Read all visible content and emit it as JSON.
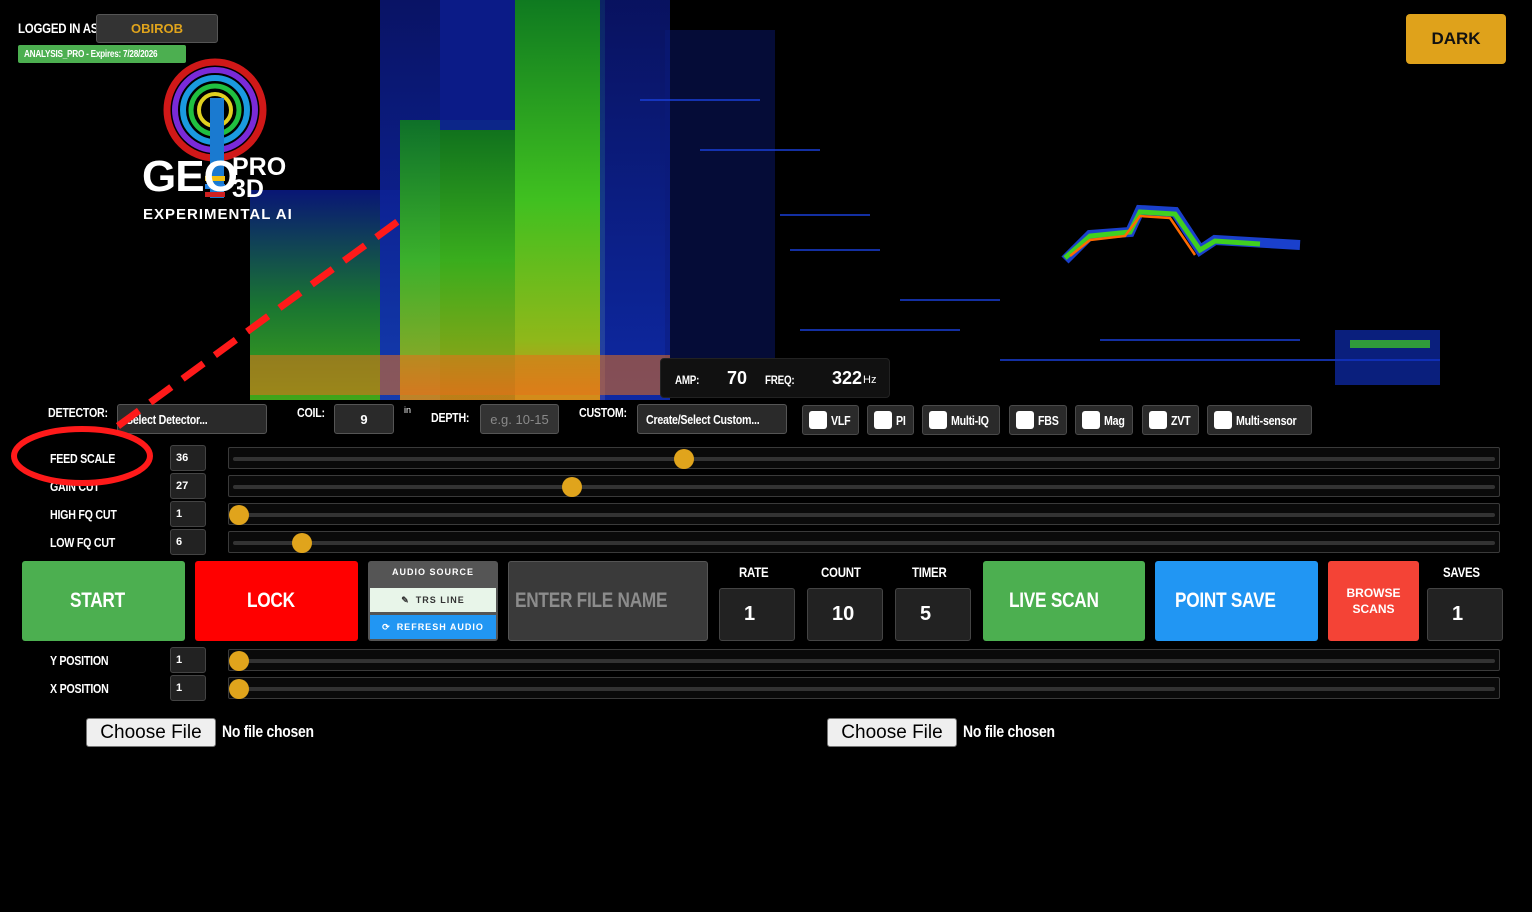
{
  "header": {
    "logged_in_label": "LOGGED IN AS:",
    "username": "OBIROB",
    "license": "ANALYSIS_PRO - Expires: 7/28/2026",
    "theme_button": "DARK"
  },
  "logo": {
    "geo": "GEO",
    "pro": "PRO",
    "threed": "3D",
    "subtitle": "EXPERIMENTAL AI"
  },
  "readout": {
    "amp_label": "AMP:",
    "amp_value": "70",
    "freq_label": "FREQ:",
    "freq_value": "322",
    "freq_unit": "Hz"
  },
  "config": {
    "detector_label": "DETECTOR:",
    "detector_value": "Select Detector...",
    "coil_label": "COIL:",
    "coil_value": "9",
    "coil_unit": "in",
    "depth_label": "DEPTH:",
    "depth_placeholder": "e.g. 10-15",
    "custom_label": "CUSTOM:",
    "custom_value": "Create/Select Custom...",
    "types": [
      {
        "label": "VLF",
        "checked": false
      },
      {
        "label": "PI",
        "checked": false
      },
      {
        "label": "Multi-IQ",
        "checked": false
      },
      {
        "label": "FBS",
        "checked": false
      },
      {
        "label": "Mag",
        "checked": false
      },
      {
        "label": "ZVT",
        "checked": false
      },
      {
        "label": "Multi-sensor",
        "checked": false
      }
    ]
  },
  "sliders": [
    {
      "label": "FEED SCALE",
      "value": "36",
      "fraction": 0.356
    },
    {
      "label": "GAIN CUT",
      "value": "27",
      "fraction": 0.266
    },
    {
      "label": "HIGH FQ CUT",
      "value": "1",
      "fraction": 0.0
    },
    {
      "label": "LOW FQ CUT",
      "value": "6",
      "fraction": 0.05
    }
  ],
  "controls": {
    "start": "START",
    "lock": "LOCK",
    "audio_source_title": "AUDIO SOURCE",
    "audio_source_value": "TRS LINE",
    "refresh_audio": "REFRESH AUDIO",
    "file_name_placeholder": "ENTER FILE NAME",
    "rate_label": "RATE",
    "rate_value": "1",
    "count_label": "COUNT",
    "count_value": "10",
    "timer_label": "TIMER",
    "timer_value": "5",
    "live_scan": "LIVE SCAN",
    "point_save": "POINT SAVE",
    "browse_scans_1": "BROWSE",
    "browse_scans_2": "SCANS",
    "saves_label": "SAVES",
    "saves_value": "1"
  },
  "position_sliders": [
    {
      "label": "Y POSITION",
      "value": "1",
      "fraction": 0.0
    },
    {
      "label": "X POSITION",
      "value": "1",
      "fraction": 0.0
    }
  ],
  "files": {
    "choose_label": "Choose File",
    "no_file": "No file chosen"
  },
  "colors": {
    "accent": "#e0a41c",
    "start": "#4caf50",
    "lock": "#ff0000",
    "live_scan": "#4caf50",
    "point_save": "#2196f3",
    "browse": "#f44336",
    "annotation": "#ff1a1a"
  }
}
